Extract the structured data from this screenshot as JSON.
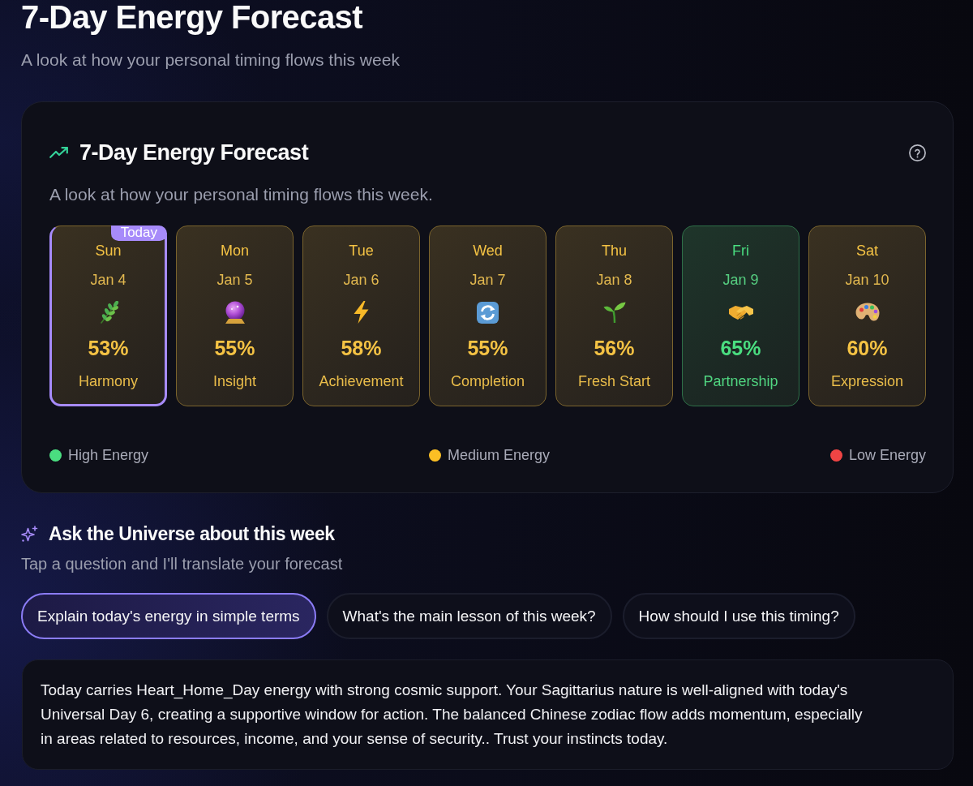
{
  "page": {
    "title": "7-Day Energy Forecast",
    "subtitle": "A look at how your personal timing flows this week"
  },
  "forecast": {
    "title": "7-Day Energy Forecast",
    "subtitle": "A look at how your personal timing flows this week.",
    "today_label": "Today",
    "days": [
      {
        "day": "Sun",
        "date": "Jan 4",
        "kind": "herb",
        "percent": "53%",
        "theme": "Harmony",
        "color": "#f5c344",
        "today": true
      },
      {
        "day": "Mon",
        "date": "Jan 5",
        "kind": "crystal-ball",
        "percent": "55%",
        "theme": "Insight",
        "color": "#f5c344",
        "today": false
      },
      {
        "day": "Tue",
        "date": "Jan 6",
        "kind": "lightning",
        "percent": "58%",
        "theme": "Achievement",
        "color": "#f5c344",
        "today": false
      },
      {
        "day": "Wed",
        "date": "Jan 7",
        "kind": "refresh",
        "percent": "55%",
        "theme": "Completion",
        "color": "#f5c344",
        "today": false
      },
      {
        "day": "Thu",
        "date": "Jan 8",
        "kind": "seedling",
        "percent": "56%",
        "theme": "Fresh Start",
        "color": "#f5c344",
        "today": false
      },
      {
        "day": "Fri",
        "date": "Jan 9",
        "kind": "handshake",
        "percent": "65%",
        "theme": "Partnership",
        "color": "#4ade80",
        "today": false
      },
      {
        "day": "Sat",
        "date": "Jan 10",
        "kind": "palette",
        "percent": "60%",
        "theme": "Expression",
        "color": "#f5c344",
        "today": false
      }
    ],
    "legend": [
      {
        "label": "High Energy",
        "color": "#4ade80"
      },
      {
        "label": "Medium Energy",
        "color": "#fbbf24"
      },
      {
        "label": "Low Energy",
        "color": "#ef4444"
      }
    ]
  },
  "ask": {
    "title": "Ask the Universe about this week",
    "subtitle": "Tap a question and I'll translate your forecast",
    "questions": [
      {
        "label": "Explain today's energy in simple terms",
        "selected": true
      },
      {
        "label": "What's the main lesson of this week?",
        "selected": false
      },
      {
        "label": "How should I use this timing?",
        "selected": false
      }
    ],
    "answer": "Today carries Heart_Home_Day energy with strong cosmic support. Your Sagittarius nature is well-aligned with today's Universal Day 6, creating a supportive window for action. The balanced Chinese zodiac flow adds momentum, especially in areas related to resources, income, and your sense of security.. Trust your instincts today."
  }
}
